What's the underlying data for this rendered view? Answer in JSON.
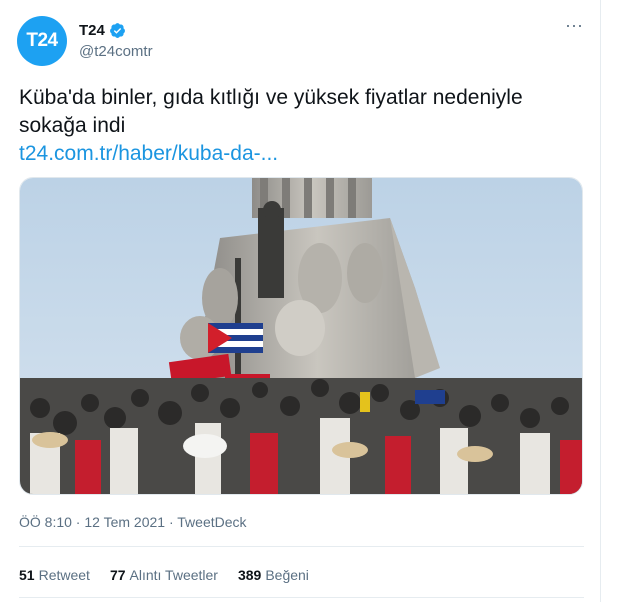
{
  "author": {
    "avatar_text": "T24",
    "name": "T24",
    "handle": "@t24comtr"
  },
  "tweet": {
    "text": "Küba'da binler, gıda kıtlığı ve yüksek fiyatlar nedeniyle sokağa indi",
    "link_text": "t24.com.tr/haber/kuba-da-..."
  },
  "meta": {
    "time": "ÖÖ 8:10",
    "sep1": " · ",
    "date": "12 Tem 2021",
    "sep2": " · ",
    "source": "TweetDeck"
  },
  "stats": {
    "retweets_count": "51",
    "retweets_label": "Retweet",
    "quotes_count": "77",
    "quotes_label": "Alıntı Tweetler",
    "likes_count": "389",
    "likes_label": "Beğeni"
  },
  "colors": {
    "accent": "#1da1f2",
    "link": "#1b95e0",
    "muted": "#5b7083"
  },
  "icons": {
    "verified": "verified-badge-icon",
    "more": "more-options-icon"
  }
}
